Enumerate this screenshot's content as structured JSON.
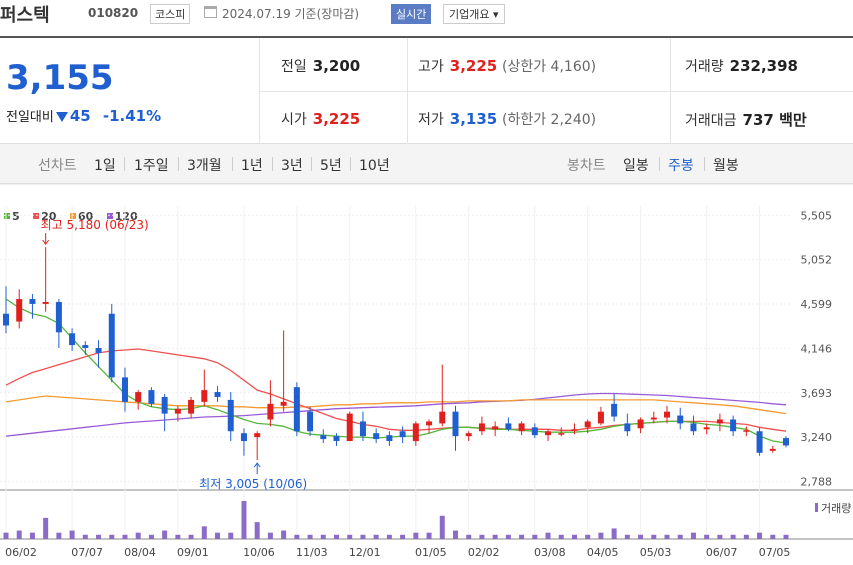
{
  "header": {
    "name": "퍼스텍",
    "code": "010820",
    "market": "코스피",
    "date": "2024.07.19 기준(장마감)",
    "realtime": "실시간",
    "company_info": "기업개요 ▾"
  },
  "quote": {
    "price": "3,155",
    "change_label": "전일대비",
    "change": "45",
    "change_pct": "-1.41%",
    "prev_label": "전일",
    "prev": "3,200",
    "high_label": "고가",
    "high": "3,225",
    "upper_limit": "(상한가 4,160)",
    "volume_label": "거래량",
    "volume": "232,398",
    "open_label": "시가",
    "open": "3,225",
    "low_label": "저가",
    "low": "3,135",
    "lower_limit": "(하한가 2,240)",
    "value_label": "거래대금",
    "value": "737 백만"
  },
  "tabs": {
    "line_label": "선차트",
    "line": [
      "1일",
      "1주일",
      "3개월",
      "1년",
      "3년",
      "5년",
      "10년"
    ],
    "candle_label": "봉차트",
    "candle": [
      "일봉",
      "주봉",
      "월봉"
    ],
    "active_candle": "주봉"
  },
  "colors": {
    "up": "#e0201d",
    "down": "#1f5fd0",
    "ma5": "#56b63a",
    "ma20": "#f05050",
    "ma60": "#f59a30",
    "ma120": "#9a5ad8",
    "volume": "#8b6bc8"
  },
  "chart_data": {
    "type": "candlestick",
    "legend": [
      "5",
      "20",
      "60",
      "120"
    ],
    "y_ticks": [
      5505,
      5052,
      4599,
      4146,
      3693,
      3240,
      2788
    ],
    "y_tick_labels": [
      "5,505",
      "5,052",
      "4,599",
      "4,146",
      "3,693",
      "3,240",
      "2,788"
    ],
    "ylim": [
      2700,
      5600
    ],
    "x_ticks": [
      "06/02",
      "07/07",
      "08/04",
      "09/01",
      "10/06",
      "11/03",
      "12/01",
      "01/05",
      "02/02",
      "03/08",
      "04/05",
      "05/03",
      "06/07",
      "07/05"
    ],
    "x_tick_index": [
      0,
      5,
      9,
      13,
      18,
      22,
      26,
      31,
      35,
      40,
      44,
      48,
      53,
      57
    ],
    "high_annotation": "최고 5,180 (06/23)",
    "low_annotation": "최저 3,005 (10/06)",
    "volume_label": "거래량",
    "candles": [
      [
        4500,
        4780,
        4300,
        4380
      ],
      [
        4420,
        4750,
        4350,
        4650
      ],
      [
        4650,
        4700,
        4450,
        4600
      ],
      [
        4600,
        5180,
        4520,
        4620
      ],
      [
        4620,
        4650,
        4150,
        4310
      ],
      [
        4300,
        4350,
        4120,
        4180
      ],
      [
        4180,
        4220,
        4080,
        4150
      ],
      [
        4150,
        4230,
        3950,
        4100
      ],
      [
        4500,
        4600,
        3800,
        3850
      ],
      [
        3850,
        3950,
        3500,
        3600
      ],
      [
        3600,
        3720,
        3520,
        3700
      ],
      [
        3720,
        3750,
        3550,
        3580
      ],
      [
        3650,
        3680,
        3300,
        3480
      ],
      [
        3480,
        3560,
        3400,
        3530
      ],
      [
        3480,
        3650,
        3430,
        3620
      ],
      [
        3600,
        3930,
        3550,
        3720
      ],
      [
        3700,
        3760,
        3600,
        3650
      ],
      [
        3620,
        3700,
        3200,
        3300
      ],
      [
        3280,
        3330,
        3050,
        3200
      ],
      [
        3240,
        3300,
        3005,
        3280
      ],
      [
        3420,
        3820,
        3350,
        3580
      ],
      [
        3560,
        4330,
        3500,
        3600
      ],
      [
        3750,
        3800,
        3250,
        3300
      ],
      [
        3500,
        3550,
        3250,
        3300
      ],
      [
        3260,
        3320,
        3180,
        3220
      ],
      [
        3250,
        3280,
        3150,
        3200
      ],
      [
        3200,
        3500,
        3200,
        3480
      ],
      [
        3400,
        3500,
        3200,
        3250
      ],
      [
        3280,
        3330,
        3180,
        3220
      ],
      [
        3260,
        3300,
        3150,
        3200
      ],
      [
        3300,
        3350,
        3180,
        3240
      ],
      [
        3200,
        3400,
        3150,
        3380
      ],
      [
        3360,
        3420,
        3280,
        3400
      ],
      [
        3380,
        3980,
        3350,
        3500
      ],
      [
        3500,
        3560,
        3100,
        3250
      ],
      [
        3250,
        3300,
        3200,
        3280
      ],
      [
        3300,
        3450,
        3260,
        3380
      ],
      [
        3320,
        3400,
        3250,
        3350
      ],
      [
        3380,
        3440,
        3300,
        3320
      ],
      [
        3300,
        3400,
        3260,
        3380
      ],
      [
        3340,
        3380,
        3230,
        3260
      ],
      [
        3260,
        3320,
        3200,
        3300
      ],
      [
        3280,
        3340,
        3250,
        3280
      ],
      [
        3320,
        3380,
        3270,
        3320
      ],
      [
        3340,
        3420,
        3280,
        3400
      ],
      [
        3380,
        3550,
        3360,
        3500
      ],
      [
        3580,
        3680,
        3400,
        3450
      ],
      [
        3380,
        3480,
        3250,
        3300
      ],
      [
        3330,
        3440,
        3280,
        3420
      ],
      [
        3420,
        3500,
        3380,
        3440
      ],
      [
        3440,
        3560,
        3380,
        3500
      ],
      [
        3460,
        3540,
        3320,
        3380
      ],
      [
        3380,
        3460,
        3260,
        3300
      ],
      [
        3320,
        3380,
        3270,
        3340
      ],
      [
        3380,
        3480,
        3300,
        3420
      ],
      [
        3420,
        3460,
        3250,
        3300
      ],
      [
        3300,
        3350,
        3250,
        3310
      ],
      [
        3300,
        3340,
        3050,
        3080
      ],
      [
        3100,
        3150,
        3080,
        3120
      ],
      [
        3230,
        3250,
        3135,
        3155
      ]
    ],
    "volumes": [
      3,
      4,
      3,
      10,
      3,
      4,
      2,
      2,
      2,
      2,
      3,
      2,
      4,
      2,
      2,
      6,
      3,
      3,
      18,
      8,
      3,
      4,
      2,
      2,
      2,
      2,
      2,
      2,
      2,
      2,
      2,
      3,
      3,
      11,
      4,
      2,
      2,
      2,
      2,
      2,
      2,
      3,
      2,
      2,
      2,
      3,
      5,
      2,
      2,
      2,
      2,
      2,
      3,
      2,
      2,
      2,
      2,
      3,
      2,
      2
    ],
    "ma5": [
      4650,
      4560,
      4500,
      4470,
      4400,
      4250,
      4100,
      3960,
      3820,
      3680,
      3600,
      3550,
      3530,
      3520,
      3530,
      3560,
      3520,
      3470,
      3420,
      3380,
      3370,
      3350,
      3300,
      3270,
      3260,
      3250,
      3240,
      3240,
      3230,
      3240,
      3250,
      3250,
      3280,
      3320,
      3340,
      3340,
      3330,
      3320,
      3320,
      3310,
      3300,
      3290,
      3290,
      3290,
      3300,
      3320,
      3350,
      3370,
      3380,
      3390,
      3400,
      3400,
      3390,
      3370,
      3360,
      3340,
      3320,
      3250,
      3200,
      3180
    ],
    "ma20": [
      3770,
      3840,
      3900,
      3940,
      3980,
      4020,
      4060,
      4100,
      4120,
      4130,
      4140,
      4120,
      4100,
      4080,
      4060,
      4040,
      4000,
      3920,
      3820,
      3720,
      3680,
      3630,
      3580,
      3530,
      3480,
      3430,
      3400,
      3370,
      3350,
      3320,
      3310,
      3310,
      3320,
      3330,
      3340,
      3340,
      3330,
      3330,
      3320,
      3320,
      3320,
      3320,
      3310,
      3310,
      3330,
      3340,
      3360,
      3370,
      3380,
      3390,
      3400,
      3400,
      3400,
      3400,
      3390,
      3380,
      3370,
      3340,
      3320,
      3300
    ],
    "ma60": [
      3600,
      3620,
      3640,
      3660,
      3650,
      3640,
      3630,
      3620,
      3610,
      3600,
      3590,
      3580,
      3570,
      3560,
      3560,
      3560,
      3560,
      3550,
      3550,
      3540,
      3540,
      3540,
      3550,
      3550,
      3560,
      3570,
      3570,
      3580,
      3580,
      3590,
      3590,
      3590,
      3600,
      3600,
      3600,
      3610,
      3610,
      3610,
      3610,
      3620,
      3620,
      3620,
      3620,
      3620,
      3620,
      3620,
      3620,
      3620,
      3620,
      3620,
      3610,
      3600,
      3590,
      3580,
      3570,
      3560,
      3540,
      3520,
      3500,
      3480
    ],
    "ma120": [
      3250,
      3265,
      3280,
      3295,
      3310,
      3325,
      3340,
      3355,
      3370,
      3385,
      3395,
      3405,
      3415,
      3425,
      3435,
      3445,
      3450,
      3455,
      3460,
      3470,
      3480,
      3490,
      3500,
      3510,
      3520,
      3530,
      3535,
      3540,
      3545,
      3550,
      3555,
      3560,
      3570,
      3580,
      3585,
      3590,
      3600,
      3605,
      3610,
      3615,
      3625,
      3640,
      3655,
      3670,
      3680,
      3685,
      3685,
      3680,
      3675,
      3670,
      3665,
      3655,
      3645,
      3635,
      3625,
      3615,
      3605,
      3595,
      3580,
      3570
    ]
  }
}
